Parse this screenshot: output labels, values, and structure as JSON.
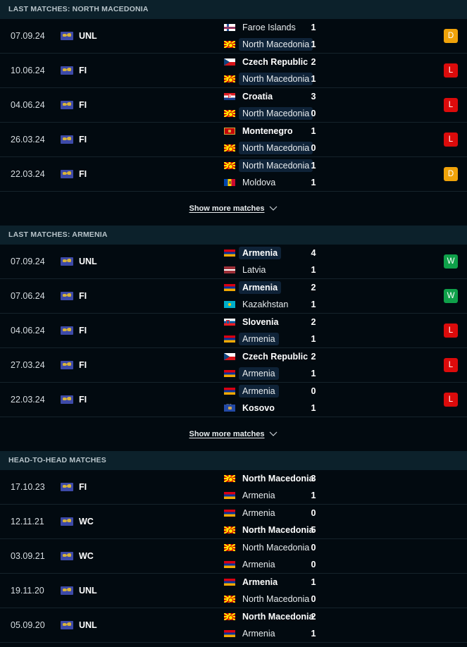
{
  "sections": [
    {
      "title": "LAST MATCHES: NORTH MACEDONIA",
      "show_more": "Show more matches",
      "matches": [
        {
          "date": "07.09.24",
          "competition": "UNL",
          "home": {
            "name": "Faroe Islands",
            "flag": "faroe-islands",
            "bold": false,
            "highlight": false
          },
          "away": {
            "name": "North Macedonia",
            "flag": "north-macedonia",
            "bold": false,
            "highlight": true
          },
          "home_score": "1",
          "away_score": "1",
          "result": "D"
        },
        {
          "date": "10.06.24",
          "competition": "FI",
          "home": {
            "name": "Czech Republic",
            "flag": "czech-republic",
            "bold": true,
            "highlight": false
          },
          "away": {
            "name": "North Macedonia",
            "flag": "north-macedonia",
            "bold": false,
            "highlight": true
          },
          "home_score": "2",
          "away_score": "1",
          "result": "L"
        },
        {
          "date": "04.06.24",
          "competition": "FI",
          "home": {
            "name": "Croatia",
            "flag": "croatia",
            "bold": true,
            "highlight": false
          },
          "away": {
            "name": "North Macedonia",
            "flag": "north-macedonia",
            "bold": false,
            "highlight": true
          },
          "home_score": "3",
          "away_score": "0",
          "result": "L"
        },
        {
          "date": "26.03.24",
          "competition": "FI",
          "home": {
            "name": "Montenegro",
            "flag": "montenegro",
            "bold": true,
            "highlight": false
          },
          "away": {
            "name": "North Macedonia",
            "flag": "north-macedonia",
            "bold": false,
            "highlight": true
          },
          "home_score": "1",
          "away_score": "0",
          "result": "L"
        },
        {
          "date": "22.03.24",
          "competition": "FI",
          "home": {
            "name": "North Macedonia",
            "flag": "north-macedonia",
            "bold": false,
            "highlight": true
          },
          "away": {
            "name": "Moldova",
            "flag": "moldova",
            "bold": false,
            "highlight": false
          },
          "home_score": "1",
          "away_score": "1",
          "result": "D"
        }
      ]
    },
    {
      "title": "LAST MATCHES: ARMENIA",
      "show_more": "Show more matches",
      "matches": [
        {
          "date": "07.09.24",
          "competition": "UNL",
          "home": {
            "name": "Armenia",
            "flag": "armenia",
            "bold": true,
            "highlight": true
          },
          "away": {
            "name": "Latvia",
            "flag": "latvia",
            "bold": false,
            "highlight": false
          },
          "home_score": "4",
          "away_score": "1",
          "result": "W"
        },
        {
          "date": "07.06.24",
          "competition": "FI",
          "home": {
            "name": "Armenia",
            "flag": "armenia",
            "bold": true,
            "highlight": true
          },
          "away": {
            "name": "Kazakhstan",
            "flag": "kazakhstan",
            "bold": false,
            "highlight": false
          },
          "home_score": "2",
          "away_score": "1",
          "result": "W"
        },
        {
          "date": "04.06.24",
          "competition": "FI",
          "home": {
            "name": "Slovenia",
            "flag": "slovenia",
            "bold": true,
            "highlight": false
          },
          "away": {
            "name": "Armenia",
            "flag": "armenia",
            "bold": false,
            "highlight": true
          },
          "home_score": "2",
          "away_score": "1",
          "result": "L"
        },
        {
          "date": "27.03.24",
          "competition": "FI",
          "home": {
            "name": "Czech Republic",
            "flag": "czech-republic",
            "bold": true,
            "highlight": false
          },
          "away": {
            "name": "Armenia",
            "flag": "armenia",
            "bold": false,
            "highlight": true
          },
          "home_score": "2",
          "away_score": "1",
          "result": "L"
        },
        {
          "date": "22.03.24",
          "competition": "FI",
          "home": {
            "name": "Armenia",
            "flag": "armenia",
            "bold": false,
            "highlight": true
          },
          "away": {
            "name": "Kosovo",
            "flag": "kosovo",
            "bold": true,
            "highlight": false
          },
          "home_score": "0",
          "away_score": "1",
          "result": "L"
        }
      ]
    },
    {
      "title": "HEAD-TO-HEAD MATCHES",
      "show_more": null,
      "matches": [
        {
          "date": "17.10.23",
          "competition": "FI",
          "home": {
            "name": "North Macedonia",
            "flag": "north-macedonia",
            "bold": true,
            "highlight": false
          },
          "away": {
            "name": "Armenia",
            "flag": "armenia",
            "bold": false,
            "highlight": false
          },
          "home_score": "3",
          "away_score": "1",
          "result": null
        },
        {
          "date": "12.11.21",
          "competition": "WC",
          "home": {
            "name": "Armenia",
            "flag": "armenia",
            "bold": false,
            "highlight": false
          },
          "away": {
            "name": "North Macedonia",
            "flag": "north-macedonia",
            "bold": true,
            "highlight": false
          },
          "home_score": "0",
          "away_score": "5",
          "result": null
        },
        {
          "date": "03.09.21",
          "competition": "WC",
          "home": {
            "name": "North Macedonia",
            "flag": "north-macedonia",
            "bold": false,
            "highlight": false
          },
          "away": {
            "name": "Armenia",
            "flag": "armenia",
            "bold": false,
            "highlight": false
          },
          "home_score": "0",
          "away_score": "0",
          "result": null
        },
        {
          "date": "19.11.20",
          "competition": "UNL",
          "home": {
            "name": "Armenia",
            "flag": "armenia",
            "bold": true,
            "highlight": false
          },
          "away": {
            "name": "North Macedonia",
            "flag": "north-macedonia",
            "bold": false,
            "highlight": false
          },
          "home_score": "1",
          "away_score": "0",
          "result": null
        },
        {
          "date": "05.09.20",
          "competition": "UNL",
          "home": {
            "name": "North Macedonia",
            "flag": "north-macedonia",
            "bold": true,
            "highlight": false
          },
          "away": {
            "name": "Armenia",
            "flag": "armenia",
            "bold": false,
            "highlight": false
          },
          "home_score": "2",
          "away_score": "1",
          "result": null
        }
      ]
    }
  ],
  "result_colors": {
    "W": "#0fa14a",
    "D": "#f0a30a",
    "L": "#dc0b0b"
  }
}
